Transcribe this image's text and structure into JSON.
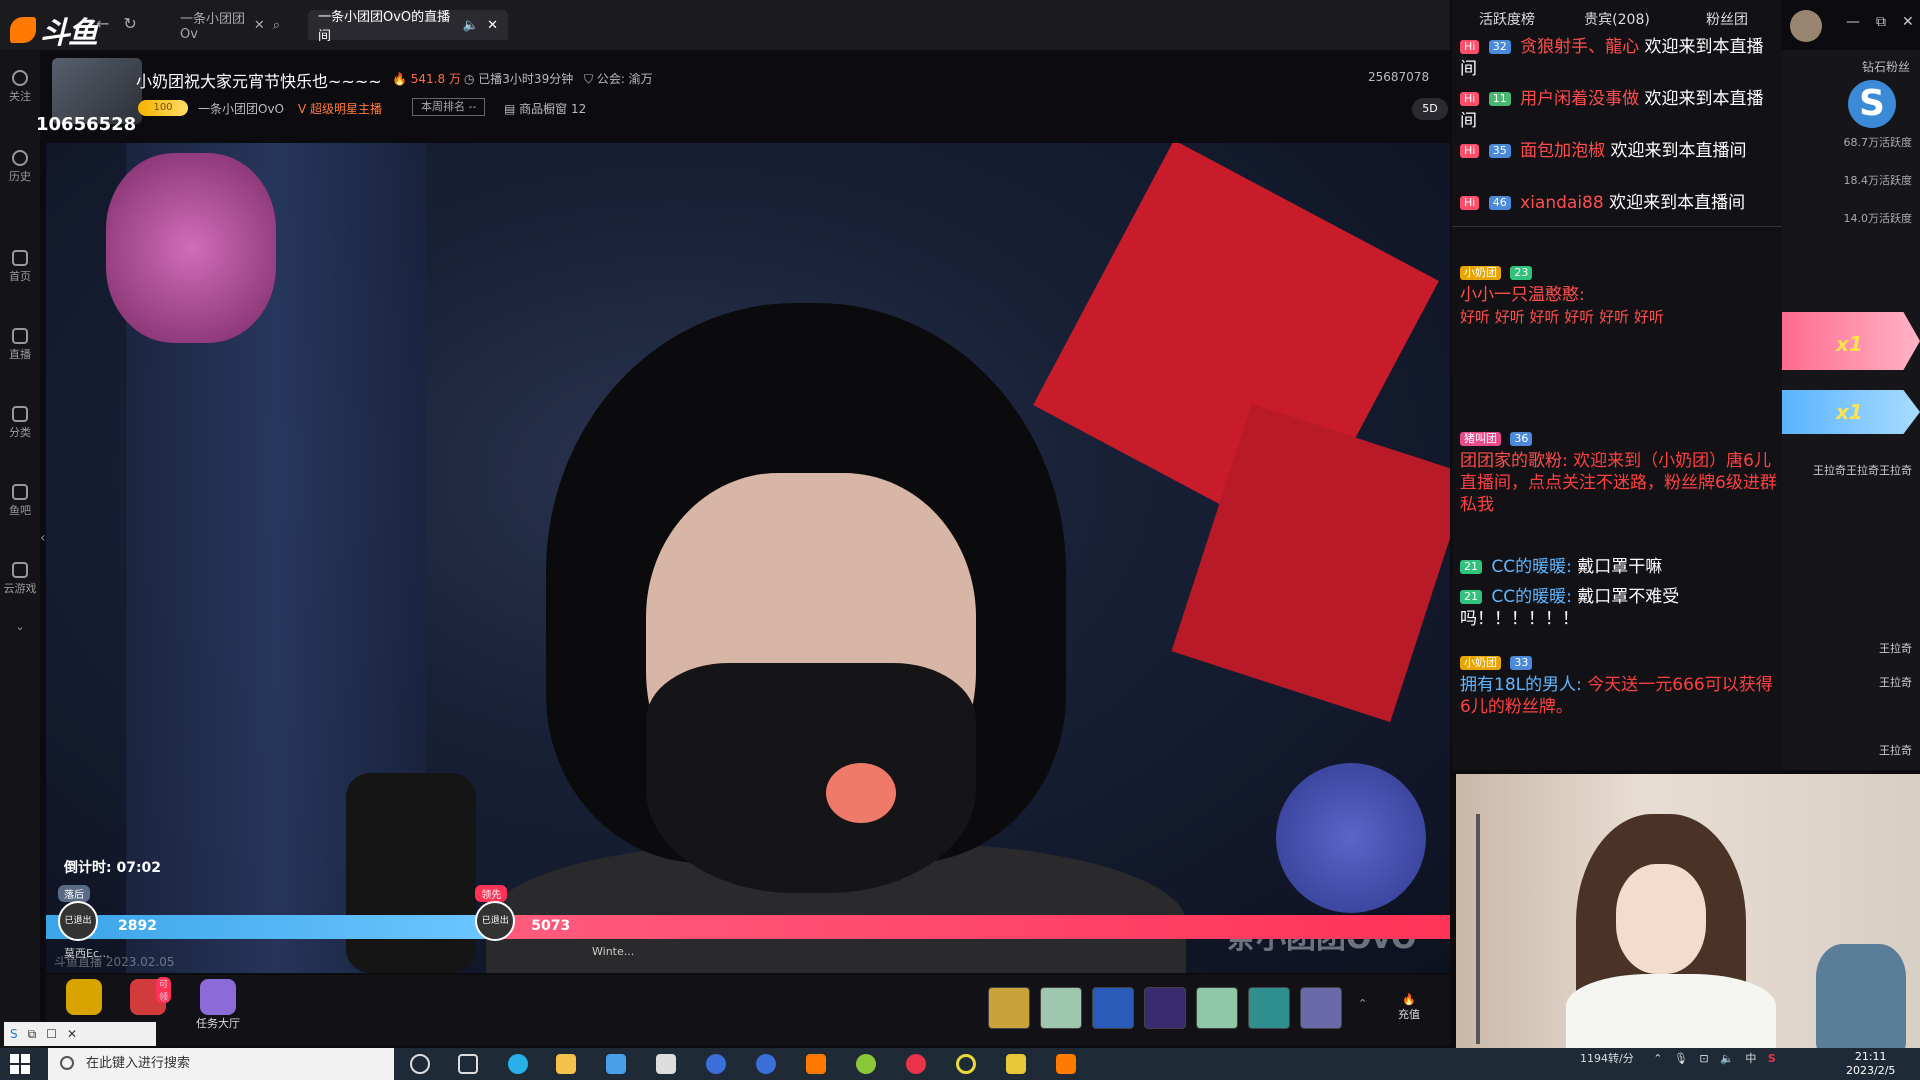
{
  "browser": {
    "logo_text": "斗鱼",
    "tabs": [
      {
        "label": "一条小团团Ov"
      },
      {
        "label": "一条小团团OvO的直播间"
      }
    ]
  },
  "sidebar": {
    "items": [
      {
        "label": "关注",
        "icon": "heart-icon"
      },
      {
        "label": "历史",
        "icon": "clock-icon"
      },
      {
        "label": "首页",
        "icon": "home-icon"
      },
      {
        "label": "直播",
        "icon": "tv-icon"
      },
      {
        "label": "分类",
        "icon": "grid-icon"
      },
      {
        "label": "鱼吧",
        "icon": "fish-icon"
      },
      {
        "label": "云游戏",
        "icon": "gamepad-icon"
      }
    ]
  },
  "room": {
    "room_id": "10656528",
    "follow_label": "关注",
    "title": "小奶团祝大家元宵节快乐也~~~~",
    "hotness": "541.8 万",
    "live_duration": "已播3小时39分钟",
    "guild": "公会: 渝万",
    "viewer_count": "25687078",
    "level": "100",
    "anchor_name": "一条小团团OvO",
    "super_anchor": "超级明星主播",
    "rank_button": "本周排名 --",
    "shop": "商品橱窗 12",
    "fived": "5D"
  },
  "video": {
    "countdown": "倒计时: 07:02",
    "watermark": "一条小团团OvO",
    "date_text": "斗鱼直播 2023.02.05",
    "pk": {
      "left_score": "2892",
      "right_score": "5073",
      "left_fraction": 0.32,
      "left_tag": "落后",
      "right_tag": "领先",
      "left_status": "已退出",
      "right_status": "已退出",
      "left_name": "莫西Ec...",
      "right_name": "Winte..."
    }
  },
  "bottom_bar": {
    "task_hall": "任务大厅",
    "gift_badge": "可领",
    "recharge": "充值"
  },
  "chat": {
    "tabs": [
      "活跃度榜",
      "贵宾(208)",
      "粉丝团"
    ],
    "messages": [
      {
        "level": "32",
        "nick": "贪狼射手、龍心",
        "text": "欢迎来到本直播间"
      },
      {
        "level": "11",
        "nick": "用户闲着没事做",
        "text": "欢迎来到本直播间"
      },
      {
        "level": "35",
        "nick": "面包加泡椒",
        "text": "欢迎来到本直播间"
      },
      {
        "level": "46",
        "nick": "xiandai88",
        "text": "欢迎来到本直播间"
      }
    ],
    "bullets": [
      {
        "badge": "小奶团",
        "level": "23",
        "nick": "小小一只温憨憨:",
        "text": "好听 好听 好听 好听 好听 好听"
      },
      {
        "badge": "猪叫团",
        "level": "36",
        "nick": "团团家的歌粉:",
        "text": "欢迎来到（小奶团）唐6儿直播间，点点关注不迷路，粉丝牌6级进群私我"
      },
      {
        "level": "21",
        "nick": "CC的暖暖:",
        "text": "戴口罩干嘛"
      },
      {
        "level": "21",
        "nick": "CC的暖暖:",
        "text": "戴口罩不难受吗！！！！！！"
      },
      {
        "badge": "小奶团",
        "level": "33",
        "nick": "拥有18L的男人:",
        "text": "今天送一元666可以获得6儿的粉丝牌。"
      }
    ]
  },
  "rank_col": {
    "header": "钻石粉丝",
    "lines": [
      "68.7万活跃度",
      "18.4万活跃度",
      "14.0万活跃度"
    ],
    "side_texts": [
      "王拉奇",
      "王拉奇王拉奇王拉奇",
      "王拉奇",
      "王拉奇",
      "王拉奇"
    ],
    "banner_mult_1": "x1",
    "banner_mult_2": "x1"
  },
  "taskbar": {
    "search_placeholder": "在此键入进行搜索",
    "net_speed": "1194转/分",
    "time": "21:11",
    "date": "2023/2/5",
    "ime": "中"
  }
}
